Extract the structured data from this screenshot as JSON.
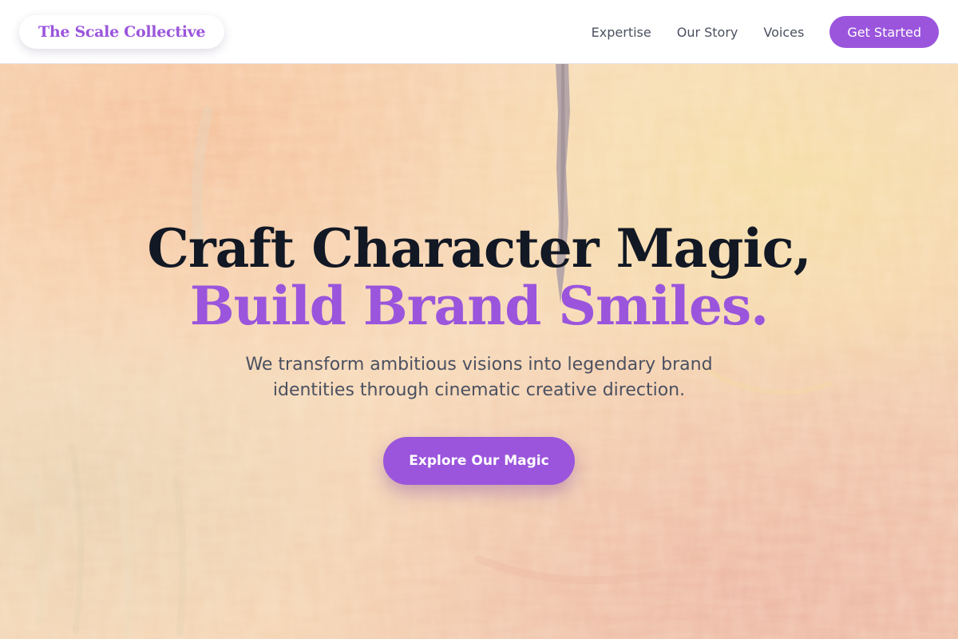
{
  "brand": {
    "name": "The Scale Collective"
  },
  "nav": {
    "links": [
      {
        "label": "Expertise"
      },
      {
        "label": "Our Story"
      },
      {
        "label": "Voices"
      }
    ],
    "cta_label": "Get Started"
  },
  "hero": {
    "headline_line1": "Craft Character Magic,",
    "headline_line2": "Build Brand Smiles.",
    "subtitle": "We transform ambitious visions into legendary brand identities through cinematic creative direction.",
    "cta_label": "Explore Our Magic",
    "background": "textured-paint-canvas"
  },
  "colors": {
    "accent": "#9a55dc",
    "headline": "#121824",
    "body_text": "#4b5060",
    "header_bg": "#ffffff",
    "hero_warm": "#f3d9b8"
  }
}
